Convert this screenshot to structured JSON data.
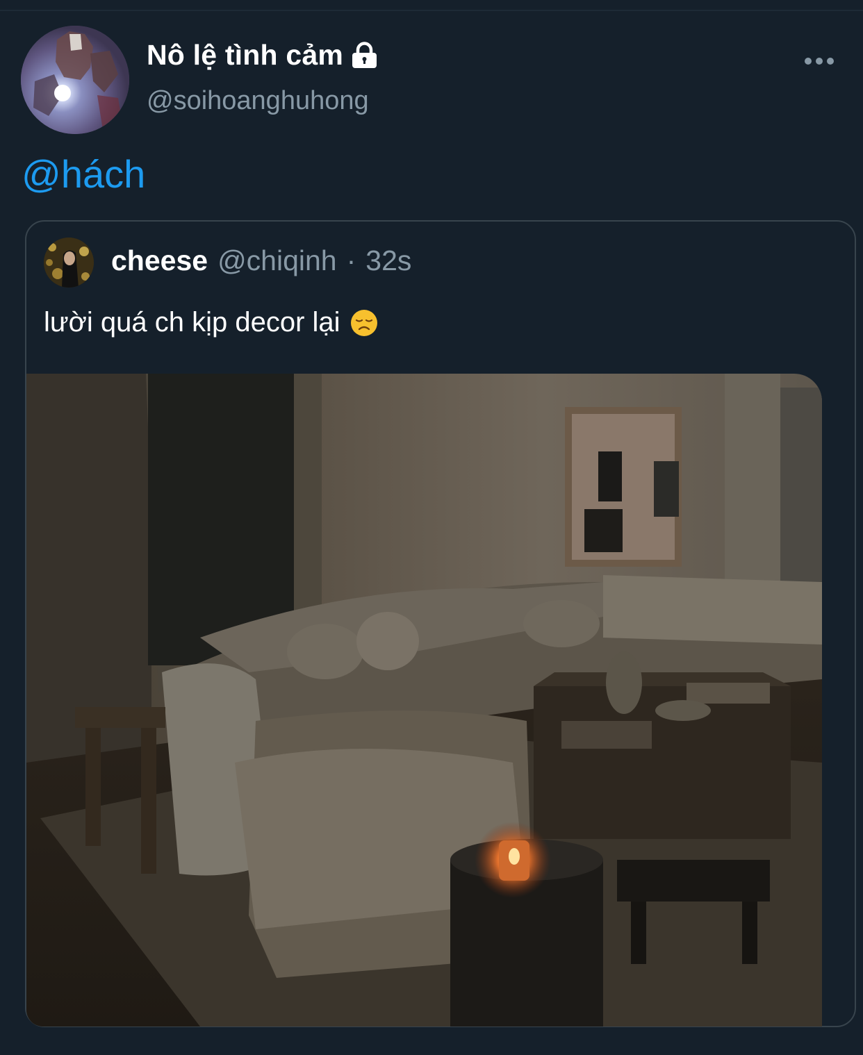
{
  "tweet": {
    "display_name": "Nô lệ tình cảm",
    "handle": "@soihoanghuhong",
    "text": "@hách",
    "more_icon": "more-horizontal-icon",
    "lock_icon": "lock-icon"
  },
  "quoted": {
    "name": "cheese",
    "handle": "@chiqinh",
    "separator": "·",
    "time": "32s",
    "text": "lười quá ch kịp decor lại",
    "emoji": "disappointed-face-emoji"
  },
  "colors": {
    "background": "#15202b",
    "link": "#1d9bf0",
    "muted": "#8899a6",
    "border": "#38444d"
  }
}
